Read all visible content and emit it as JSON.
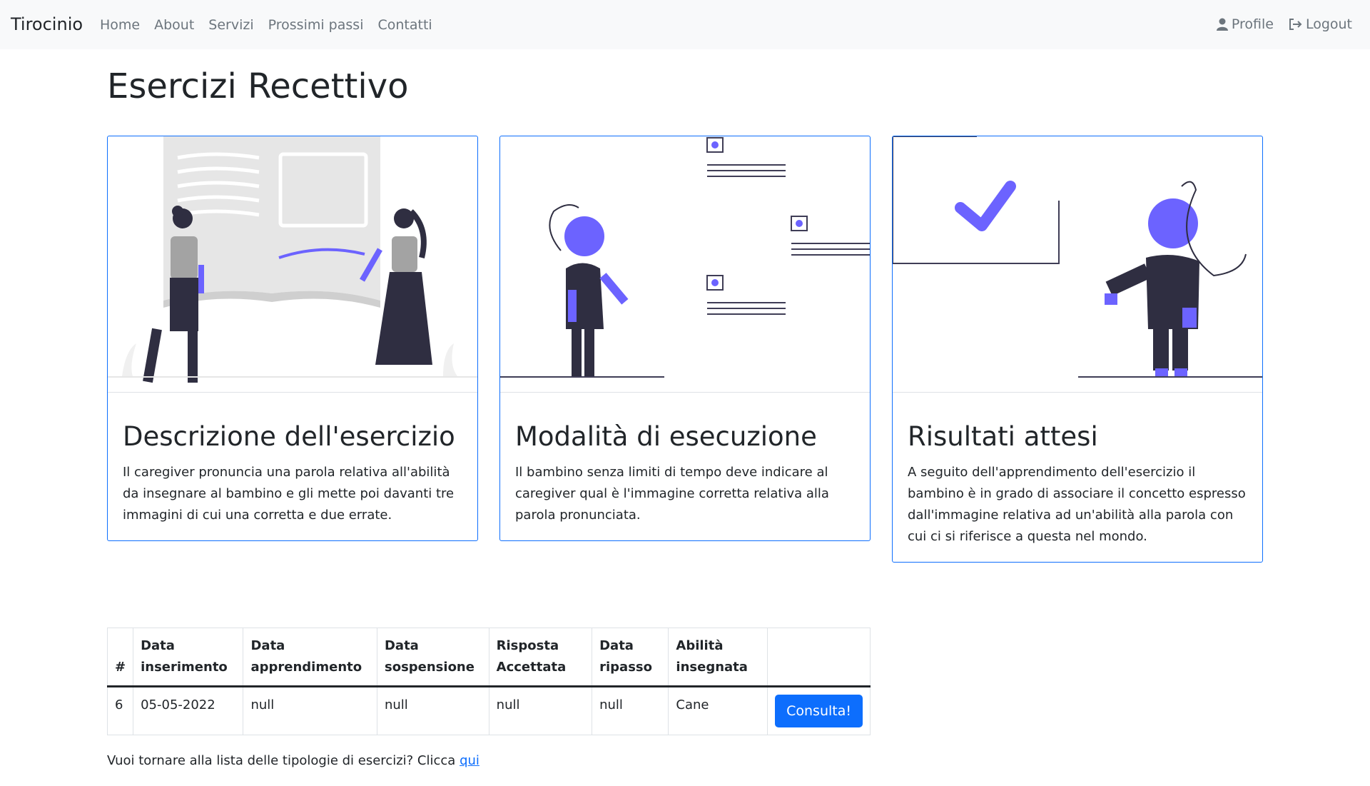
{
  "navbar": {
    "brand": "Tirocinio",
    "links": [
      "Home",
      "About",
      "Servizi",
      "Prossimi passi",
      "Contatti"
    ],
    "profile_label": "Profile",
    "logout_label": "Logout"
  },
  "page": {
    "title": "Esercizi Recettivo"
  },
  "cards": [
    {
      "title": "Descrizione dell'esercizio",
      "text": "Il caregiver pronuncia una parola relativa all'abilità da insegnare al bambino e gli mette poi davanti tre immagini di cui una corretta e due errate."
    },
    {
      "title": "Modalità di esecuzione",
      "text": "Il bambino senza limiti di tempo deve indicare al caregiver qual è l'immagine corretta relativa alla parola pronunciata."
    },
    {
      "title": "Risultati attesi",
      "text": "A seguito dell'apprendimento dell'esercizio il bambino è in grado di associare il concetto espresso dall'immagine relativa ad un'abilità alla parola con cui ci si riferisce a questa nel mondo."
    }
  ],
  "table": {
    "headers": [
      "#",
      "Data inserimento",
      "Data apprendimento",
      "Data sospensione",
      "Risposta Accettata",
      "Data ripasso",
      "Abilità insegnata",
      ""
    ],
    "rows": [
      [
        "6",
        "05-05-2022",
        "null",
        "null",
        "null",
        "null",
        "Cane"
      ]
    ],
    "button_label": "Consulta!"
  },
  "footer": {
    "text": "Vuoi tornare alla lista delle tipologie di esercizi? Clicca",
    "link": "qui"
  },
  "colors": {
    "accent": "#0d6efd",
    "illustration_purple": "#6c63ff",
    "dark": "#2f2e41"
  }
}
